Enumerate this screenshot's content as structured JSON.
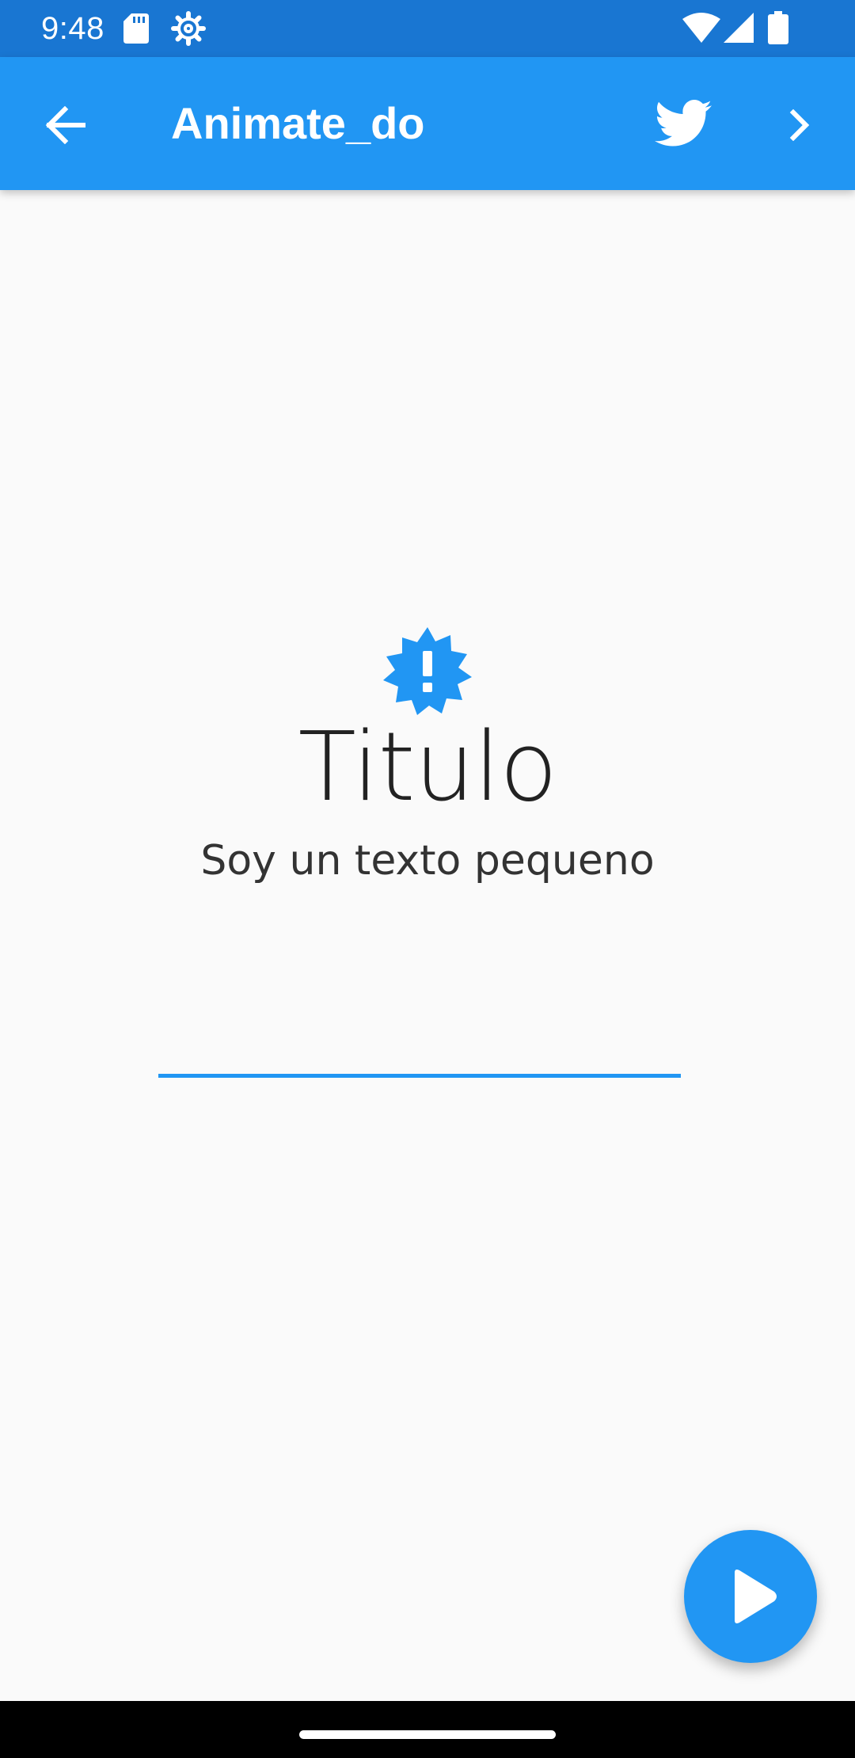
{
  "status_bar": {
    "time": "9:48",
    "icons": [
      "sd-card-icon",
      "settings-gear-icon",
      "wifi-icon",
      "cellular-signal-icon",
      "battery-icon"
    ]
  },
  "app_bar": {
    "title": "Animate_do",
    "background_color": "#2196f3",
    "icons": [
      "back-arrow-icon",
      "twitter-icon",
      "chevron-right-icon"
    ]
  },
  "main": {
    "icon": "new-releases-badge-icon",
    "title": "Titulo",
    "subtitle": "Soy un texto pequeno",
    "accent_color": "#2196f3"
  },
  "fab": {
    "icon": "play-icon"
  },
  "nav_bar": {
    "icon": "home-indicator"
  }
}
